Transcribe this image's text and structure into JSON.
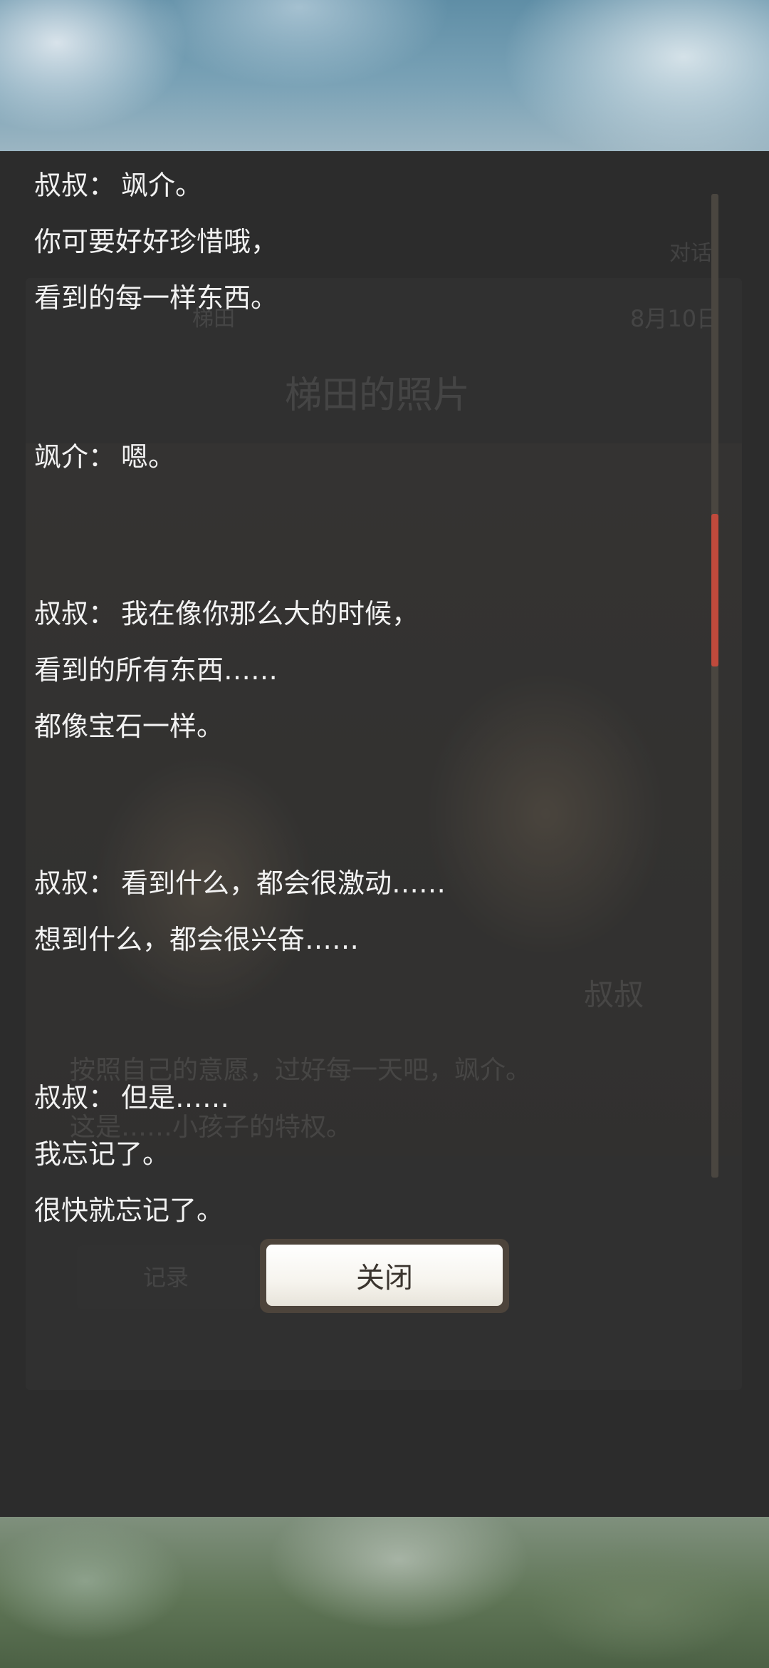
{
  "log": {
    "entries": [
      {
        "speaker": "叔叔：",
        "lines": [
          "飒介。",
          "你可要好好珍惜哦，",
          "看到的每一样东西。"
        ]
      },
      {
        "speaker": "飒介：",
        "lines": [
          "嗯。"
        ]
      },
      {
        "speaker": "叔叔：",
        "lines": [
          "我在像你那么大的时候，",
          "看到的所有东西……",
          "都像宝石一样。"
        ]
      },
      {
        "speaker": "叔叔：",
        "lines": [
          "看到什么，都会很激动……",
          "想到什么，都会很兴奋……"
        ]
      },
      {
        "speaker": "叔叔：",
        "lines": [
          "但是……",
          "我忘记了。",
          "很快就忘记了。"
        ]
      }
    ]
  },
  "scrollbar": {
    "thumb_start": 0.325,
    "thumb_end": 0.48
  },
  "close_button": {
    "label": "关闭"
  },
  "background_scene": {
    "title": "梯田的照片",
    "tag": "对话",
    "date": "8月10日",
    "location": "梯田",
    "speaker_name": "叔叔",
    "dialogue_line1": "按照自己的意愿，过好每一天吧，飒介。",
    "dialogue_line2": "这是……小孩子的特权。",
    "record_button": "记录"
  },
  "colors": {
    "overlay": "#2c2c2c",
    "text": "#f2f2f2",
    "scroll_track": "#4a4640",
    "scroll_thumb": "#c04a3c",
    "button_face": "#f6f4ee"
  }
}
